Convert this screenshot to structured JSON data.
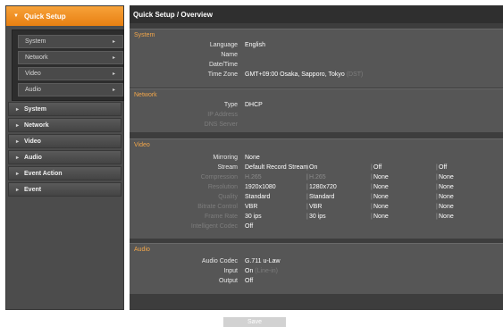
{
  "sidebar": {
    "quick_setup": "Quick Setup",
    "sub_items": [
      {
        "label": "System"
      },
      {
        "label": "Network"
      },
      {
        "label": "Video"
      },
      {
        "label": "Audio"
      }
    ],
    "menu": [
      {
        "label": "System"
      },
      {
        "label": "Network"
      },
      {
        "label": "Video"
      },
      {
        "label": "Audio"
      },
      {
        "label": "Event Action"
      },
      {
        "label": "Event"
      }
    ]
  },
  "main": {
    "title": "Quick Setup / Overview",
    "system": {
      "title": "System",
      "language_label": "Language",
      "language_value": "English",
      "name_label": "Name",
      "datetime_label": "Date/Time",
      "timezone_label": "Time Zone",
      "timezone_value": "GMT+09:00 Osaka, Sapporo, Tokyo",
      "timezone_dst": "(DST)"
    },
    "network": {
      "title": "Network",
      "type_label": "Type",
      "type_value": "DHCP",
      "ip_label": "IP Address",
      "dns_label": "DNS Server"
    },
    "video": {
      "title": "Video",
      "mirroring_label": "Mirroring",
      "mirroring_value": "None",
      "rows": [
        {
          "label": "Stream",
          "dim": false,
          "c1": "Default Record Stream",
          "c2": "On",
          "c3": "Off",
          "c4": "Off"
        },
        {
          "label": "Compression",
          "dim": true,
          "c1": "H.265",
          "c2": "H.265",
          "c3": "None",
          "c4": "None"
        },
        {
          "label": "Resolution",
          "dim": true,
          "c1": "1920x1080",
          "c2": "1280x720",
          "c3": "None",
          "c4": "None"
        },
        {
          "label": "Quality",
          "dim": true,
          "c1": "Standard",
          "c2": "Standard",
          "c3": "None",
          "c4": "None"
        },
        {
          "label": "Bitrate Control",
          "dim": true,
          "c1": "VBR",
          "c2": "VBR",
          "c3": "None",
          "c4": "None"
        },
        {
          "label": "Frame Rate",
          "dim": true,
          "c1": "30 ips",
          "c2": "30 ips",
          "c3": "None",
          "c4": "None"
        }
      ],
      "intelligent_label": "Intelligent Codec",
      "intelligent_value": "Off"
    },
    "audio": {
      "title": "Audio",
      "codec_label": "Audio Codec",
      "codec_value": "G.711 u-Law",
      "input_label": "Input",
      "input_value": "On",
      "input_detail": "(Line-in)",
      "output_label": "Output",
      "output_value": "Off"
    }
  },
  "footer": {
    "save_label": "Save"
  }
}
